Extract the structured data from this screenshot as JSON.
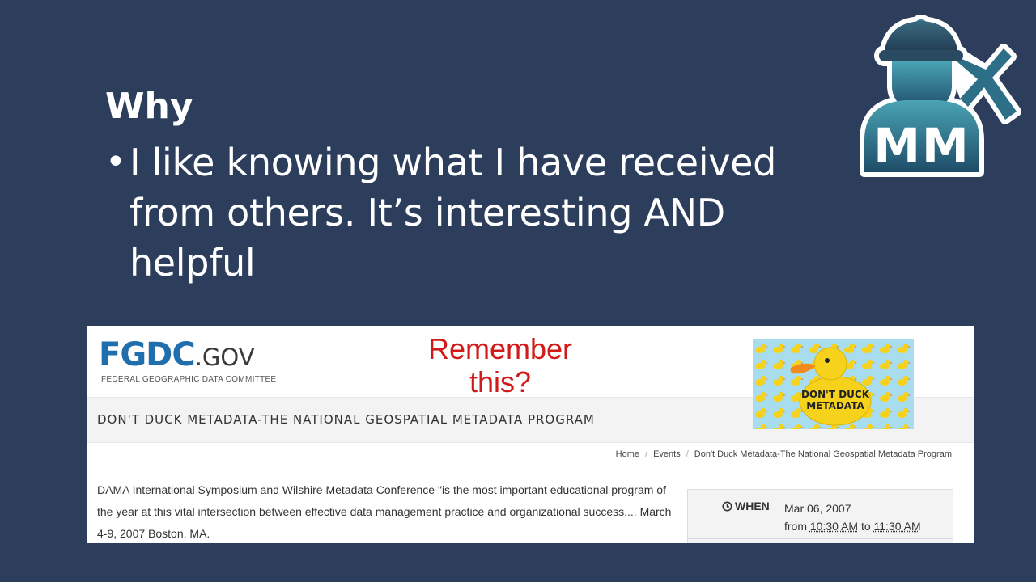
{
  "slide": {
    "heading": "Why",
    "bullet_char": "•",
    "bullet_text": "I like knowing what I have received from others. It’s interesting AND helpful"
  },
  "logo": {
    "initials": "MM",
    "icon": "miner-with-pickaxe-icon"
  },
  "web": {
    "fgdc_main": "FGDC",
    "fgdc_gov": ".GOV",
    "fgdc_sub": "FEDERAL GEOGRAPHIC DATA COMMITTEE",
    "callout_line1": "Remember",
    "callout_line2": "this?",
    "event_title": "DON'T DUCK METADATA-THE NATIONAL GEOSPATIAL METADATA PROGRAM",
    "banner_text_line1": "DON'T DUCK",
    "banner_text_line2": "METADATA",
    "breadcrumb": {
      "home": "Home",
      "events": "Events",
      "current": "Don't Duck Metadata-The National Geospatial Metadata Program",
      "separator": "/"
    },
    "body_text": "DAMA International Symposium and Wilshire Metadata Conference \"is the most important educational program of the year at this vital intersection between effective data management practice and organizational success.... March 4-9, 2007 Boston, MA.",
    "when": {
      "label": "WHEN",
      "date": "Mar 06, 2007",
      "from_word": "from",
      "start": "10:30 AM",
      "to_word": "to",
      "end": "11:30 AM"
    }
  },
  "colors": {
    "slide_bg": "#2c3e5c",
    "fgdc_blue": "#1f6fae",
    "callout_red": "#d11a1a",
    "banner_bg": "#a8dcef",
    "duck_yellow": "#f6d21c"
  }
}
